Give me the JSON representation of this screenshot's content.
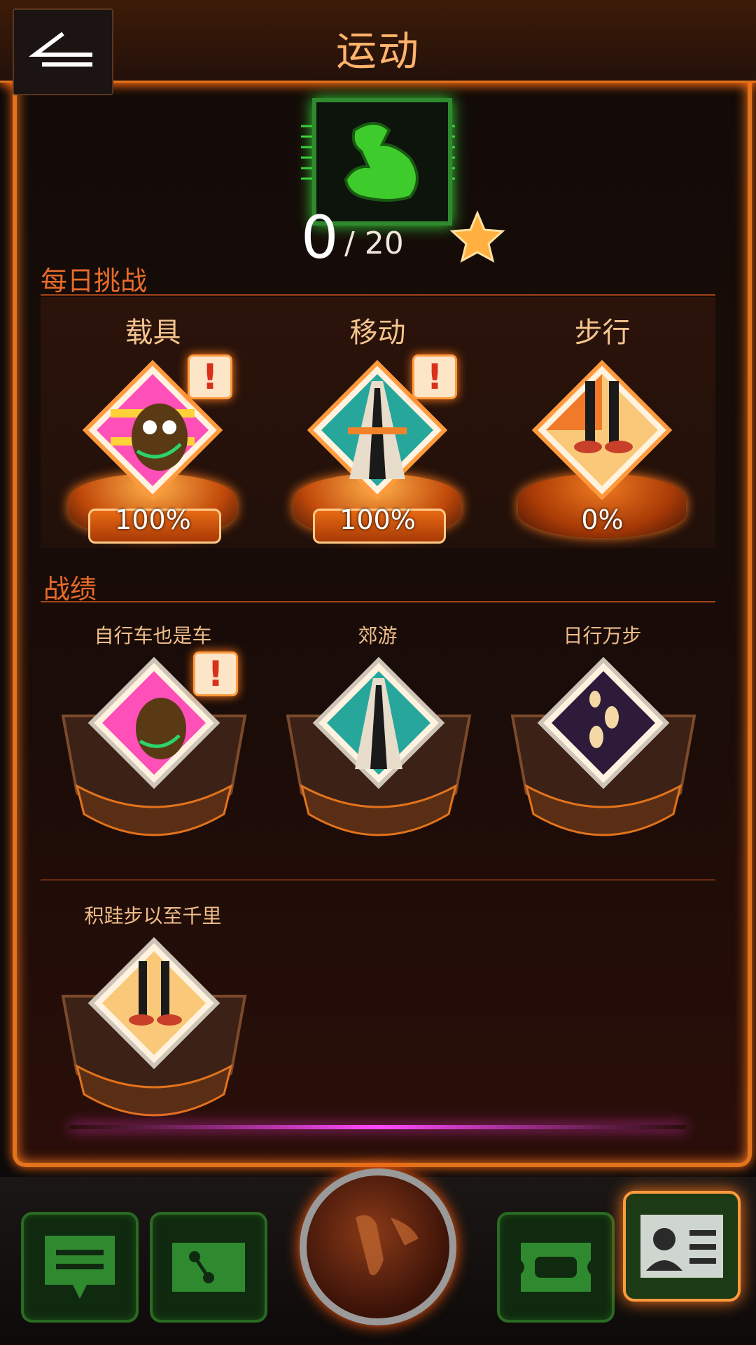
{
  "header": {
    "title": "运动",
    "back_icon": "back-arrow-icon"
  },
  "score": {
    "current": "0",
    "total": "/ 20",
    "icon": "star-icon",
    "badge_icon": "flexed-arm-icon"
  },
  "daily": {
    "title": "每日挑战",
    "items": [
      {
        "label": "载具",
        "percent": "100%",
        "progress": 1.0,
        "icon": "horse-icon",
        "alert": "!"
      },
      {
        "label": "移动",
        "percent": "100%",
        "progress": 1.0,
        "icon": "road-icon",
        "alert": "!"
      },
      {
        "label": "步行",
        "percent": "0%",
        "progress": 0.0,
        "icon": "walking-legs-icon"
      }
    ]
  },
  "records": {
    "title": "战绩",
    "items": [
      {
        "label": "自行车也是车",
        "icon": "horse-icon",
        "alert": "!"
      },
      {
        "label": "郊游",
        "icon": "road-icon"
      },
      {
        "label": "日行万步",
        "icon": "footprints-icon"
      },
      {
        "label": "积跬步以至千里",
        "icon": "walking-legs-icon"
      }
    ]
  },
  "nav": {
    "items": [
      {
        "icon": "chat-icon"
      },
      {
        "icon": "share-ticket-icon"
      },
      {
        "icon": "globe-icon"
      },
      {
        "icon": "ticket-icon"
      },
      {
        "icon": "id-card-icon"
      }
    ]
  },
  "colors": {
    "accent": "#e2731c",
    "panel": "#2b130a",
    "green": "#39d139"
  }
}
